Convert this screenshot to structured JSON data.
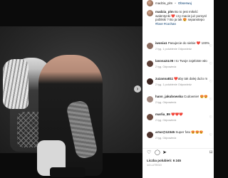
{
  "post": {
    "username": "madzia_plm",
    "follow_label": "Obserwuj",
    "caption_user": "madzia_plm",
    "caption_text": "Bo to jest miłość",
    "caption_tail1": "walentynki ❤️ czy macie już pomysł",
    "caption_tail2": "pobliski ? Bo ja tak 😍 sepanstepo",
    "caption_tags": "#love #cochan",
    "likes_label": "Liczba polubień: 6 245",
    "date": "14 LUTEGO"
  },
  "comments": [
    {
      "user": "iwonia1",
      "text": "Pasujecie do siebie ❤️ 100%",
      "meta": "2 tyg.   1 polubienie   Odpowiedz",
      "color": "#8d6e63"
    },
    {
      "user": "lasosa24.05",
      "text": "I to Twoje zajebiste wło",
      "meta": "2 tyg.   Odpowiedz",
      "color": "#5d4037"
    },
    {
      "user": "zuzanna811",
      "text": "❤️aby tak dalej dużo m",
      "meta": "2 tyg.   1 polubienie   Odpowiedz",
      "color": "#3e2723"
    },
    {
      "user": "hann_jakubowska",
      "text": "Cudownie! 😍😍",
      "meta": "2 tyg.   Odpowiedz",
      "color": "#a1887f"
    },
    {
      "user": "marlia_89",
      "text": "❤️❤️❤️",
      "meta": "2 tyg.   Odpowiedz",
      "color": "#6d4c41"
    },
    {
      "user": "artur@12345",
      "text": "Super foto 😍😍😍",
      "meta": "2 tyg.   Odpowiedz",
      "color": "#4e342e"
    }
  ],
  "icons": {
    "like": "♡",
    "comment": "◯",
    "share": "➤",
    "save": "⌑",
    "next": "›",
    "more": "···"
  }
}
